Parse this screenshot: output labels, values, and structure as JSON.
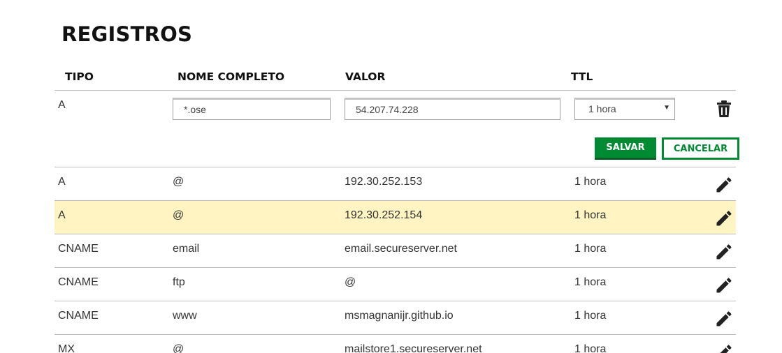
{
  "page": {
    "title": "REGISTROS"
  },
  "table": {
    "headers": {
      "type": "TIPO",
      "name": "NOME COMPLETO",
      "value": "VALOR",
      "ttl": "TTL"
    },
    "edit_row": {
      "type": "A",
      "name_value": "*.ose",
      "value_value": "54.207.74.228",
      "ttl_selected": "1 hora",
      "delete_icon": "trash-icon"
    },
    "actions": {
      "save_label": "SALVAR",
      "cancel_label": "CANCELAR"
    },
    "rows": [
      {
        "type": "A",
        "name": "@",
        "value": "192.30.252.153",
        "ttl": "1 hora",
        "highlighted": false
      },
      {
        "type": "A",
        "name": "@",
        "value": "192.30.252.154",
        "ttl": "1 hora",
        "highlighted": true
      },
      {
        "type": "CNAME",
        "name": "email",
        "value": "email.secureserver.net",
        "ttl": "1 hora",
        "highlighted": false
      },
      {
        "type": "CNAME",
        "name": "ftp",
        "value": "@",
        "ttl": "1 hora",
        "highlighted": false
      },
      {
        "type": "CNAME",
        "name": "www",
        "value": "msmagnanijr.github.io",
        "ttl": "1 hora",
        "highlighted": false
      },
      {
        "type": "MX",
        "name": "@",
        "value": "mailstore1.secureserver.net",
        "ttl": "1 hora",
        "highlighted": false
      }
    ],
    "row_action_icon": "pencil-icon"
  },
  "colors": {
    "accent": "#008a32",
    "highlight_row": "#fff4c2",
    "divider": "#bdbdbd",
    "icon": "#222222"
  }
}
